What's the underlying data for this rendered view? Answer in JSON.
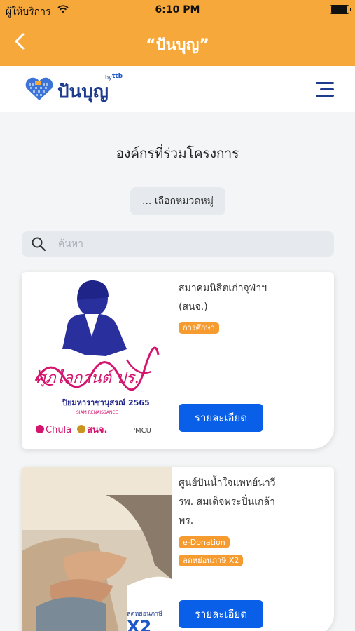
{
  "status_bar": {
    "carrier": "ผู้ให้บริการ",
    "time": "6:10 PM"
  },
  "nav": {
    "title": "“ปันบุญ”"
  },
  "header": {
    "logo_text": "ปันบุญ",
    "logo_by": "by",
    "logo_ttb": "ttb"
  },
  "main": {
    "title": "องค์กรที่ร่วมโครงการ",
    "category_label": "... เลือกหมวดหมู่",
    "search": {
      "placeholder": "ค้นหา",
      "value": ""
    }
  },
  "cards": [
    {
      "name_line1": "สมาคมนิสิตเก่าจุฬาฯ",
      "name_line2": "(สนจ.)",
      "tags": [
        "การศึกษา"
      ],
      "button": "รายละเอียด",
      "image": {
        "signature": "ศุภไลกานต์ ปร.",
        "event": "ปิยมหาราชานุสรณ์ 2565",
        "subtitle": "SIAM RENAISSANCE",
        "sponsors": [
          "Chula",
          "สนจ.",
          "PMCU"
        ]
      }
    },
    {
      "name_line1": "ศูนย์ปันน้ำใจแพทย์นาวี",
      "name_line2": "รพ. สมเด็จพระปิ่นเกล้า",
      "name_line3": "พร.",
      "tags": [
        "e-Donation",
        "ลดหย่อนภาษี X2"
      ],
      "button": "รายละเอียด",
      "image": {
        "badge_text": "ลดหย่อนภาษี",
        "badge_x2": "X2"
      }
    }
  ],
  "colors": {
    "nav_bg": "#f7a83a",
    "brand_blue": "#1d3c8f",
    "button_blue": "#0a5fe8",
    "tag_orange": "#f59b30"
  }
}
